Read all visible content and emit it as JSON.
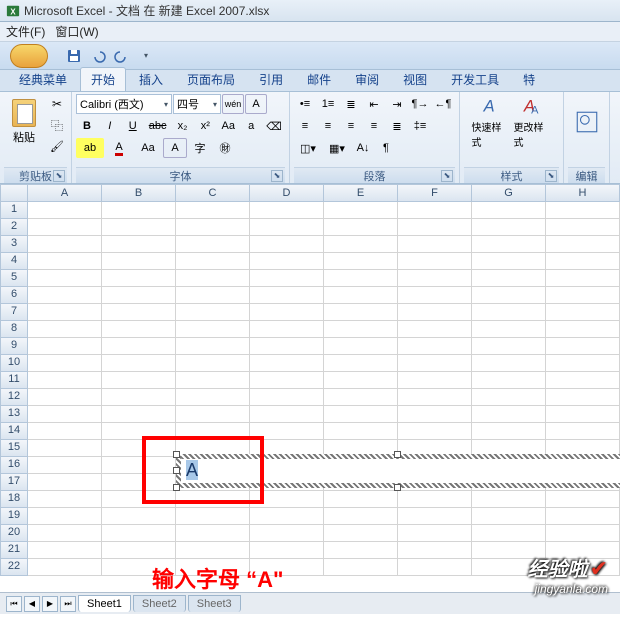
{
  "window": {
    "title": "Microsoft Excel - 文档 在 新建 Excel 2007.xlsx"
  },
  "menubar": {
    "file": "文件(F)",
    "window": "窗口(W)"
  },
  "ribbon_tabs": {
    "t0": "经典菜单",
    "t1": "开始",
    "t2": "插入",
    "t3": "页面布局",
    "t4": "引用",
    "t5": "邮件",
    "t6": "审阅",
    "t7": "视图",
    "t8": "开发工具",
    "t9": "特"
  },
  "groups": {
    "clipboard": {
      "label": "剪贴板",
      "paste": "粘贴"
    },
    "font": {
      "label": "字体",
      "font_name": "Calibri (西文)",
      "font_size": "四号",
      "bold": "B",
      "italic": "I",
      "underline": "U",
      "strike": "abc",
      "sub": "x₂",
      "sup": "x²",
      "highlight": "ab",
      "color": "A",
      "grow": "Aa",
      "shrink": "a",
      "case": "A",
      "clear": "⌫",
      "char_border": "A",
      "char_shade": "A",
      "pinyin": "拼",
      "wen": "wén",
      "boxA": "A"
    },
    "paragraph": {
      "label": "段落"
    },
    "styles": {
      "label": "样式",
      "quick": "快速样式",
      "change": "更改样式"
    },
    "editing": {
      "label": "编辑"
    }
  },
  "columns": [
    "A",
    "B",
    "C",
    "D",
    "E",
    "F",
    "G",
    "H"
  ],
  "row_count": 22,
  "textbox": {
    "value": "A"
  },
  "annotation": "输入字母 “A\"",
  "sheets": {
    "s1": "Sheet1",
    "s2": "Sheet2",
    "s3": "Sheet3"
  },
  "watermark": {
    "big": "经验啦",
    "small": "jingyanla.com"
  }
}
